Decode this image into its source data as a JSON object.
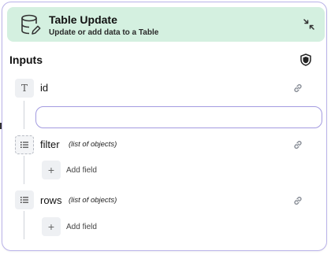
{
  "header": {
    "title": "Table Update",
    "subtitle": "Update or add data to a Table",
    "icon": "database-edit-icon",
    "collapse_icon": "collapse-arrows-icon",
    "background": "#d4f0e0"
  },
  "inputs": {
    "title": "Inputs",
    "shield_icon": "shield-icon",
    "fields": [
      {
        "label": "id",
        "type": "",
        "icon": "text-type-icon",
        "type_letter": "T",
        "value": "",
        "placeholder": ""
      },
      {
        "label": "filter",
        "type": "(list of objects)",
        "icon": "list-icon",
        "add_label": "Add field"
      },
      {
        "label": "rows",
        "type": "(list of objects)",
        "icon": "list-icon",
        "add_label": "Add field"
      }
    ]
  },
  "colors": {
    "border_accent": "#b9b2e8",
    "input_border": "#a39be0"
  }
}
